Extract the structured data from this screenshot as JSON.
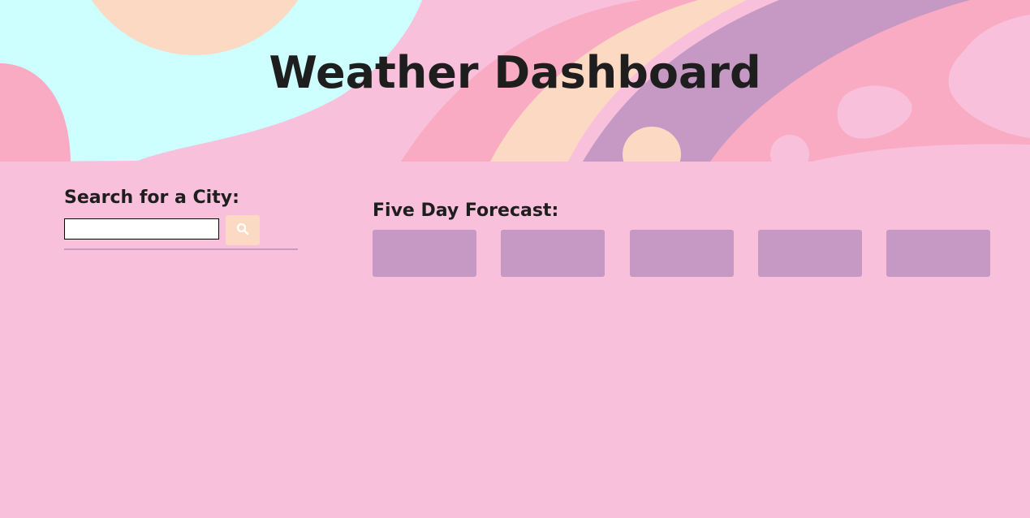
{
  "header": {
    "title": "Weather Dashboard"
  },
  "search": {
    "heading": "Search for a City:",
    "input_value": "",
    "placeholder": "",
    "button_icon": "search-icon"
  },
  "forecast": {
    "heading": "Five Day Forecast:",
    "cards": [
      {
        "content": ""
      },
      {
        "content": ""
      },
      {
        "content": ""
      },
      {
        "content": ""
      },
      {
        "content": ""
      }
    ]
  },
  "colors": {
    "background": "#f9c0dc",
    "card": "#c599c3",
    "button": "#fcd9c2",
    "title_text": "#1e1e1e",
    "header_cyan": "#ccfffe",
    "header_peach": "#fcd9c2",
    "header_pink": "#f8abc2",
    "header_purple": "#c599c3"
  }
}
